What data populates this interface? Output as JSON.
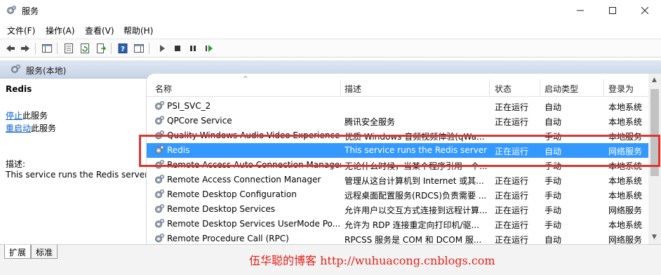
{
  "window": {
    "title": "服务"
  },
  "menu": [
    "文件(F)",
    "操作(A)",
    "查看(V)",
    "帮助(H)"
  ],
  "toolbar_icons": [
    "back-icon",
    "forward-icon",
    "show-hide-console-tree-icon",
    "properties-icon",
    "refresh-icon",
    "export-list-icon",
    "help-icon",
    "show-hide-action-pane-icon",
    "start-service-icon",
    "stop-service-icon",
    "pause-service-icon",
    "restart-service-icon"
  ],
  "header": {
    "title": "服务(本地)"
  },
  "left_pane": {
    "service_name": "Redis",
    "stop_link": "停止",
    "stop_suffix": "此服务",
    "restart_link": "重启动",
    "restart_suffix": "此服务",
    "desc_label": "描述:",
    "desc_text": "This service runs the Redis server"
  },
  "columns": {
    "name": "名称",
    "desc": "描述",
    "status": "状态",
    "startup": "启动类型",
    "logon": "登录为"
  },
  "rows": [
    {
      "name": "PSI_SVC_2",
      "desc": "",
      "status": "正在运行",
      "startup": "自动",
      "logon": "本地系统"
    },
    {
      "name": "QPCore Service",
      "desc": "腾讯安全服务",
      "status": "正在运行",
      "startup": "自动",
      "logon": "本地系统"
    },
    {
      "name": "Quality Windows Audio Video Experience",
      "desc": "优质 Windows 音频视频体验(qWa...",
      "status": "",
      "startup": "手动",
      "logon": "本地服务"
    },
    {
      "name": "Redis",
      "desc": "This service runs the Redis server",
      "status": "正在运行",
      "startup": "自动",
      "logon": "网络服务"
    },
    {
      "name": "Remote Access Auto Connection Manager",
      "desc": "无论什么时候，当某个程序引用一个...",
      "status": "",
      "startup": "手动",
      "logon": "本地系统"
    },
    {
      "name": "Remote Access Connection Manager",
      "desc": "管理从这台计算机到 Internet 或其...",
      "status": "正在运行",
      "startup": "手动",
      "logon": "本地系统"
    },
    {
      "name": "Remote Desktop Configuration",
      "desc": "远程桌面配置服务(RDCS)负责需要 ...",
      "status": "正在运行",
      "startup": "手动",
      "logon": "本地系统"
    },
    {
      "name": "Remote Desktop Services",
      "desc": "允许用户以交互方式连接到远程计算...",
      "status": "正在运行",
      "startup": "手动",
      "logon": "网络服务"
    },
    {
      "name": "Remote Desktop Services UserMode Po...",
      "desc": "允许为 RDP 连接重定向打印机/驱...",
      "status": "正在运行",
      "startup": "手动",
      "logon": "本地系统"
    },
    {
      "name": "Remote Procedure Call (RPC)",
      "desc": "RPCSS 服务是 COM 和 DCOM 服...",
      "status": "正在运行",
      "startup": "自动",
      "logon": "网络服务"
    }
  ],
  "selected_row": 3,
  "tabs": [
    "扩展",
    "标准"
  ],
  "watermark": "伍华聪的博客 http://wuhuacong.cnblogs.com",
  "colors": {
    "selection": "#3399ff",
    "highlight_box": "#d9372f",
    "watermark": "#e0211b",
    "link": "#0b5fc5"
  }
}
